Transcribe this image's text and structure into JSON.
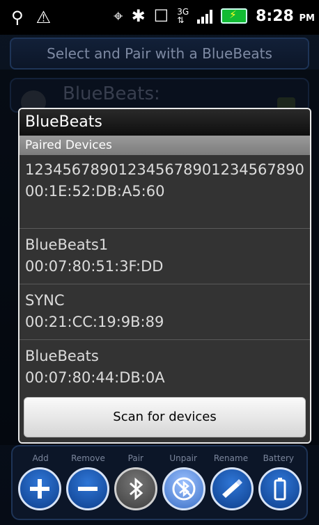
{
  "status_bar": {
    "time": "8:28",
    "ampm": "PM",
    "icons": [
      "usb-icon",
      "warning-icon",
      "gps-icon",
      "bluetooth-icon",
      "vibrate-icon",
      "3g-icon",
      "signal-icon",
      "battery-charging-icon"
    ]
  },
  "header": {
    "title": "Select and Pair with a BlueBeats"
  },
  "background_list": {
    "row_title": "BlueBeats:"
  },
  "dialog": {
    "title": "BlueBeats",
    "section": "Paired Devices",
    "devices": [
      {
        "name": "123456789012345678901234567890",
        "address": "00:1E:52:DB:A5:60"
      },
      {
        "name": "BlueBeats1",
        "address": "00:07:80:51:3F:DD"
      },
      {
        "name": "SYNC",
        "address": "00:21:CC:19:9B:89"
      },
      {
        "name": "BlueBeats",
        "address": "00:07:80:44:DB:0A"
      }
    ],
    "scan_button": "Scan for devices"
  },
  "toolbar": {
    "labels": [
      "Add",
      "Remove",
      "Pair",
      "Unpair",
      "Rename",
      "Battery"
    ],
    "icons": [
      "plus-icon",
      "minus-icon",
      "bluetooth-icon",
      "bluetooth-unpair-icon",
      "rename-icon",
      "battery-icon"
    ]
  }
}
